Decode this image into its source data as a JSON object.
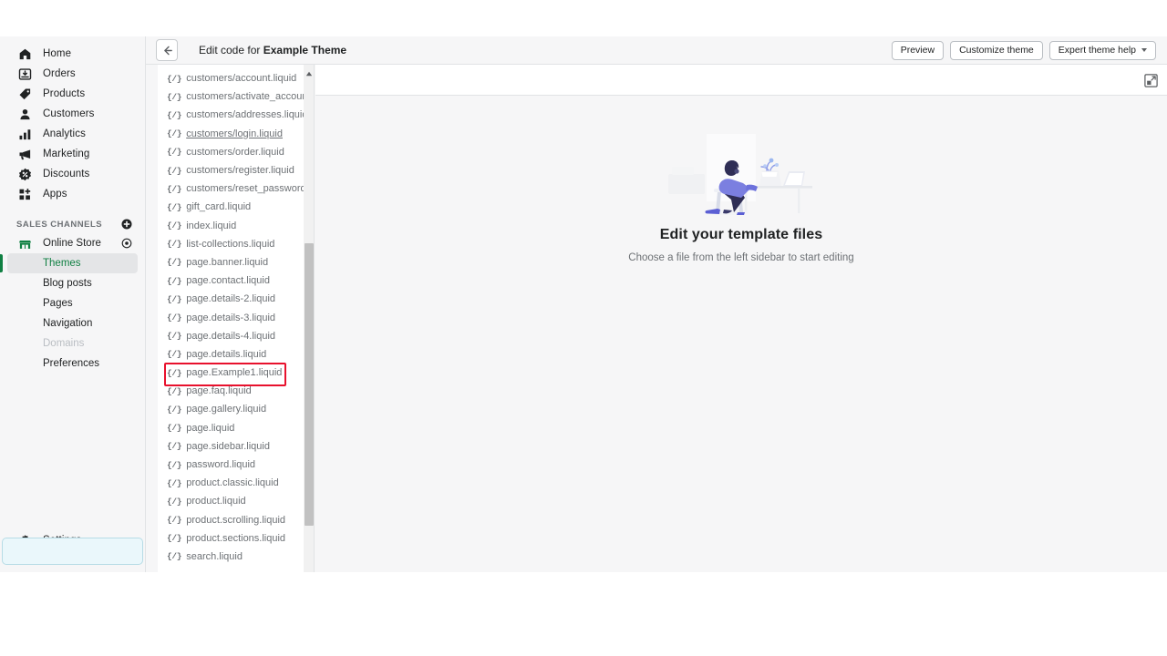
{
  "header": {
    "back_icon": "arrow-left-icon",
    "title_prefix": "Edit code for ",
    "title_theme": "Example Theme",
    "buttons": [
      {
        "label": "Preview",
        "name": "preview-button",
        "caret": false
      },
      {
        "label": "Customize theme",
        "name": "customize-theme-button",
        "caret": false
      },
      {
        "label": "Expert theme help",
        "name": "expert-theme-help-button",
        "caret": true
      }
    ]
  },
  "sidebar": {
    "primary": [
      {
        "label": "Home",
        "icon": "home-icon"
      },
      {
        "label": "Orders",
        "icon": "orders-icon"
      },
      {
        "label": "Products",
        "icon": "products-tag-icon"
      },
      {
        "label": "Customers",
        "icon": "customers-person-icon"
      },
      {
        "label": "Analytics",
        "icon": "analytics-bars-icon"
      },
      {
        "label": "Marketing",
        "icon": "marketing-megaphone-icon"
      },
      {
        "label": "Discounts",
        "icon": "discounts-badge-icon"
      },
      {
        "label": "Apps",
        "icon": "apps-grid-icon"
      }
    ],
    "sales_channels_label": "SALES CHANNELS",
    "add_channel_icon": "plus-circle-icon",
    "online_store": {
      "label": "Online Store",
      "icon": "storefront-icon",
      "view_icon": "eye-icon"
    },
    "store_items": [
      {
        "label": "Themes",
        "selected": true,
        "disabled": false
      },
      {
        "label": "Blog posts",
        "selected": false,
        "disabled": false
      },
      {
        "label": "Pages",
        "selected": false,
        "disabled": false
      },
      {
        "label": "Navigation",
        "selected": false,
        "disabled": false
      },
      {
        "label": "Domains",
        "selected": false,
        "disabled": true
      },
      {
        "label": "Preferences",
        "selected": false,
        "disabled": false
      }
    ],
    "settings": {
      "label": "Settings",
      "icon": "gear-icon"
    },
    "accent_color": "#108043"
  },
  "file_list": {
    "file_icon": "{/}",
    "files": [
      {
        "name": "customers/account.liquid",
        "hovered": false,
        "annotated": false
      },
      {
        "name": "customers/activate_account.li",
        "hovered": false,
        "annotated": false
      },
      {
        "name": "customers/addresses.liquid",
        "hovered": false,
        "annotated": false
      },
      {
        "name": "customers/login.liquid",
        "hovered": true,
        "annotated": false
      },
      {
        "name": "customers/order.liquid",
        "hovered": false,
        "annotated": false
      },
      {
        "name": "customers/register.liquid",
        "hovered": false,
        "annotated": false
      },
      {
        "name": "customers/reset_password.liq",
        "hovered": false,
        "annotated": false
      },
      {
        "name": "gift_card.liquid",
        "hovered": false,
        "annotated": false
      },
      {
        "name": "index.liquid",
        "hovered": false,
        "annotated": false
      },
      {
        "name": "list-collections.liquid",
        "hovered": false,
        "annotated": false
      },
      {
        "name": "page.banner.liquid",
        "hovered": false,
        "annotated": false
      },
      {
        "name": "page.contact.liquid",
        "hovered": false,
        "annotated": false
      },
      {
        "name": "page.details-2.liquid",
        "hovered": false,
        "annotated": false
      },
      {
        "name": "page.details-3.liquid",
        "hovered": false,
        "annotated": false
      },
      {
        "name": "page.details-4.liquid",
        "hovered": false,
        "annotated": false
      },
      {
        "name": "page.details.liquid",
        "hovered": false,
        "annotated": false
      },
      {
        "name": "page.Example1.liquid",
        "hovered": false,
        "annotated": true
      },
      {
        "name": "page.faq.liquid",
        "hovered": false,
        "annotated": false
      },
      {
        "name": "page.gallery.liquid",
        "hovered": false,
        "annotated": false
      },
      {
        "name": "page.liquid",
        "hovered": false,
        "annotated": false
      },
      {
        "name": "page.sidebar.liquid",
        "hovered": false,
        "annotated": false
      },
      {
        "name": "password.liquid",
        "hovered": false,
        "annotated": false
      },
      {
        "name": "product.classic.liquid",
        "hovered": false,
        "annotated": false
      },
      {
        "name": "product.liquid",
        "hovered": false,
        "annotated": false
      },
      {
        "name": "product.scrolling.liquid",
        "hovered": false,
        "annotated": false
      },
      {
        "name": "product.sections.liquid",
        "hovered": false,
        "annotated": false
      },
      {
        "name": "search.liquid",
        "hovered": false,
        "annotated": false
      }
    ],
    "annotation_color": "#e8112d",
    "scroll_up_icon": "scroll-up-arrow-icon"
  },
  "main": {
    "expand_icon": "open-in-new-window-icon",
    "empty_title": "Edit your template files",
    "empty_subtitle": "Choose a file from the left sidebar to start editing",
    "illustration": "person-at-desk-illustration"
  }
}
